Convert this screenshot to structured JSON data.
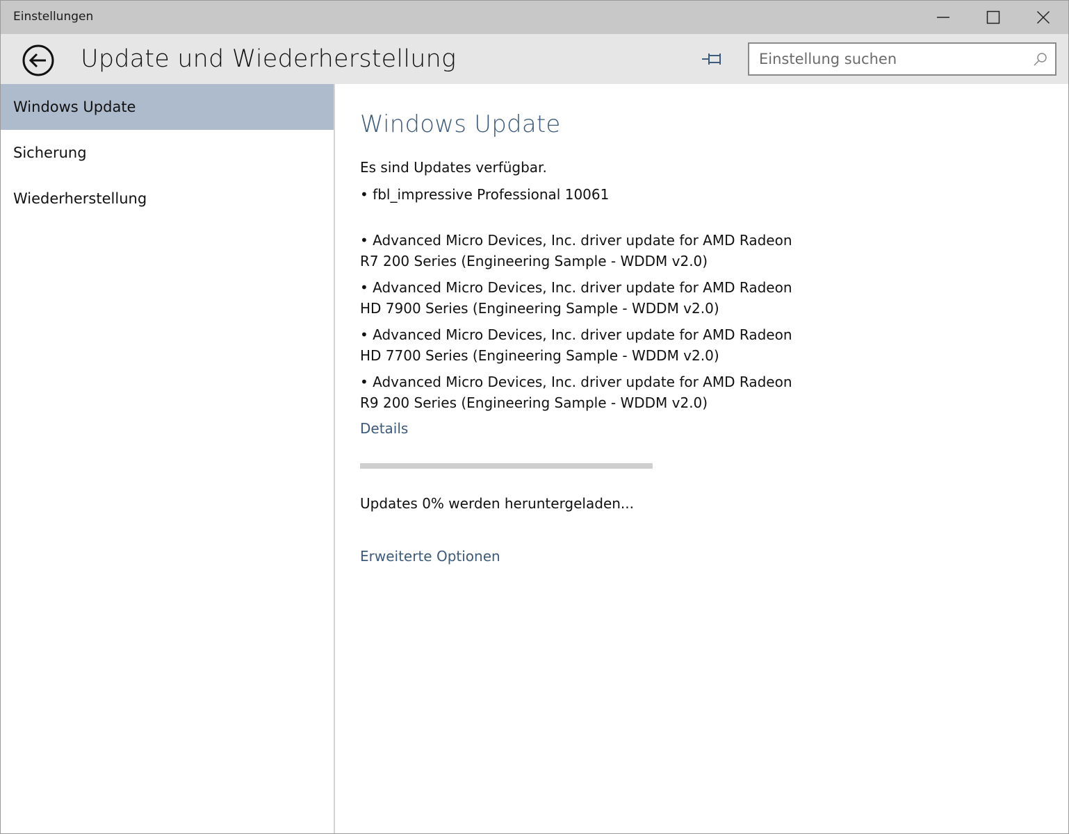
{
  "window": {
    "app_title": "Einstellungen"
  },
  "header": {
    "page_title": "Update und Wiederherstellung",
    "search_placeholder": "Einstellung suchen"
  },
  "sidebar": {
    "items": [
      {
        "label": "Windows Update",
        "active": true
      },
      {
        "label": "Sicherung",
        "active": false
      },
      {
        "label": "Wiederherstellung",
        "active": false
      }
    ]
  },
  "main": {
    "title": "Windows Update",
    "status": "Es sind Updates verfügbar.",
    "updates": [
      "• fbl_impressive Professional 10061",
      "• Advanced Micro Devices, Inc. driver update for AMD Radeon R7 200 Series (Engineering Sample - WDDM v2.0)",
      "• Advanced Micro Devices, Inc. driver update for AMD Radeon HD 7900 Series (Engineering Sample - WDDM v2.0)",
      "• Advanced Micro Devices, Inc. driver update for AMD Radeon HD 7700 Series (Engineering Sample - WDDM v2.0)",
      "• Advanced Micro Devices, Inc. driver update for AMD Radeon R9 200 Series (Engineering Sample - WDDM v2.0)"
    ],
    "details_link": "Details",
    "progress_percent": 0,
    "progress_text": "Updates 0% werden heruntergeladen...",
    "advanced_link": "Erweiterte Optionen"
  },
  "icons": {
    "back": "back-arrow-icon",
    "pin": "pin-icon",
    "search": "search-icon",
    "minimize": "minimize-icon",
    "maximize": "maximize-icon",
    "close": "close-icon"
  },
  "colors": {
    "accent": "#3b5a7c",
    "nav_active": "#aebbcc",
    "titlebar": "#c8c8c8",
    "header": "#e6e6e6"
  }
}
